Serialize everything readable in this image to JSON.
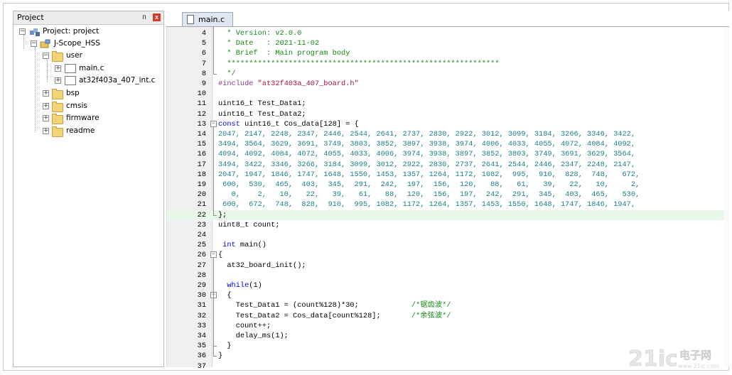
{
  "project_panel": {
    "title": "Project",
    "pin_glyph": "ᴨ",
    "close_glyph": "x",
    "tree": {
      "root": "Project: project",
      "target": "J-Scope_HSS",
      "group_user": "user",
      "file_main": "main.c",
      "file_int": "at32f403a_407_int.c",
      "group_bsp": "bsp",
      "group_cmsis": "cmsis",
      "group_firmware": "firmware",
      "group_readme": "readme"
    }
  },
  "editor": {
    "tab_label": "main.c",
    "lines": [
      {
        "n": "4",
        "text": "  * Version: v2.0.0",
        "cls": "c-comment"
      },
      {
        "n": "5",
        "text": "  * Date   : 2021-11-02",
        "cls": "c-comment"
      },
      {
        "n": "6",
        "text": "  * Brief  : Main program body",
        "cls": "c-comment"
      },
      {
        "n": "7",
        "text": "  **************************************************************",
        "cls": "c-comment"
      },
      {
        "n": "8",
        "text": "  */",
        "cls": "c-comment"
      },
      {
        "n": "9",
        "text": "#include \"at32f403a_407_board.h\"",
        "cls": "mixed-include"
      },
      {
        "n": "10",
        "text": "",
        "cls": "c-plain"
      },
      {
        "n": "11",
        "text": "uint16_t Test_Data1;",
        "cls": "c-plain"
      },
      {
        "n": "12",
        "text": "uint16_t Test_Data2;",
        "cls": "c-plain"
      },
      {
        "n": "13",
        "text": "const uint16_t Cos_data[128] = {",
        "cls": "mixed-const"
      },
      {
        "n": "14",
        "text": "2047, 2147, 2248, 2347, 2446, 2544, 2641, 2737, 2830, 2922, 3012, 3099, 3184, 3266, 3346, 3422,",
        "cls": "c-num"
      },
      {
        "n": "15",
        "text": "3494, 3564, 3629, 3691, 3749, 3803, 3852, 3897, 3938, 3974, 4006, 4033, 4055, 4072, 4084, 4092,",
        "cls": "c-num"
      },
      {
        "n": "16",
        "text": "4094, 4092, 4084, 4072, 4055, 4033, 4006, 3974, 3938, 3897, 3852, 3803, 3749, 3691, 3629, 3564,",
        "cls": "c-num"
      },
      {
        "n": "17",
        "text": "3494, 3422, 3346, 3266, 3184, 3099, 3012, 2922, 2830, 2737, 2641, 2544, 2446, 2347, 2248, 2147,",
        "cls": "c-num"
      },
      {
        "n": "18",
        "text": "2047, 1947, 1846, 1747, 1648, 1550, 1453, 1357, 1264, 1172, 1082,  995,  910,  828,  748,   672,",
        "cls": "c-num"
      },
      {
        "n": "19",
        "text": " 600,  530,  465,  403,  345,  291,  242,  197,  156,  120,   88,   61,   39,   22,   10,     2,",
        "cls": "c-num"
      },
      {
        "n": "20",
        "text": "   0,    2,   10,   22,   39,   61,   88,  120,  156,  197,  242,  291,  345,  403,  465,   530,",
        "cls": "c-num"
      },
      {
        "n": "21",
        "text": " 600,  672,  748,  828,  910,  995, 1082, 1172, 1264, 1357, 1453, 1550, 1648, 1747, 1846, 1947,",
        "cls": "c-num"
      },
      {
        "n": "22",
        "text": "};",
        "cls": "c-plain"
      },
      {
        "n": "23",
        "text": "uint8_t count;",
        "cls": "c-plain"
      },
      {
        "n": "24",
        "text": "",
        "cls": "c-plain"
      },
      {
        "n": "25",
        "text": " int main()",
        "cls": "mixed-int"
      },
      {
        "n": "26",
        "text": "{",
        "cls": "c-plain"
      },
      {
        "n": "27",
        "text": "  at32_board_init();",
        "cls": "c-plain"
      },
      {
        "n": "28",
        "text": "",
        "cls": "c-plain"
      },
      {
        "n": "29",
        "text": "  while(1)",
        "cls": "mixed-while"
      },
      {
        "n": "30",
        "text": "  {",
        "cls": "c-plain"
      },
      {
        "n": "31",
        "text": "    Test_Data1 = (count%128)*30;",
        "comment": "/*锯齿波*/",
        "cls": "mixed-comment"
      },
      {
        "n": "32",
        "text": "    Test_Data2 = Cos_data[count%128];",
        "comment": "/*余弦波*/",
        "cls": "mixed-comment"
      },
      {
        "n": "33",
        "text": "    count++;",
        "cls": "c-plain"
      },
      {
        "n": "34",
        "text": "    delay_ms(1);",
        "cls": "c-plain"
      },
      {
        "n": "35",
        "text": "  }",
        "cls": "c-plain"
      },
      {
        "n": "36",
        "text": "}",
        "cls": "c-plain"
      },
      {
        "n": "37",
        "text": "",
        "cls": "c-plain"
      }
    ],
    "highlight_line": "22",
    "fold_marker_collapse": "−"
  },
  "watermark": {
    "brand": "21ic",
    "cn": "电子网",
    "url": "www.21ic.com"
  },
  "colors": {
    "comment": "#168a16",
    "preprocessor": "#8b3d8b",
    "string": "#a0143c",
    "keyword": "#0000ee",
    "number": "#1a7f8a",
    "highlight": "#e8f7e8"
  }
}
